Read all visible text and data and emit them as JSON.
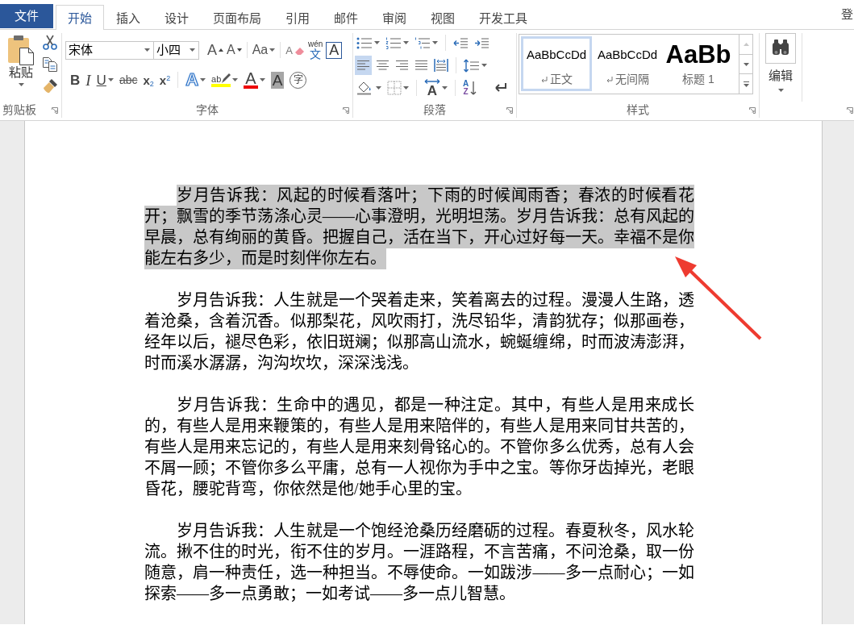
{
  "file_tab": {
    "label": "文件"
  },
  "tabs": [
    {
      "label": "开始",
      "selected": true
    },
    {
      "label": "插入",
      "selected": false
    },
    {
      "label": "设计",
      "selected": false
    },
    {
      "label": "页面布局",
      "selected": false
    },
    {
      "label": "引用",
      "selected": false
    },
    {
      "label": "邮件",
      "selected": false
    },
    {
      "label": "审阅",
      "selected": false
    },
    {
      "label": "视图",
      "selected": false
    },
    {
      "label": "开发工具",
      "selected": false
    }
  ],
  "account": {
    "label": "登"
  },
  "clipboard": {
    "label": "剪贴板",
    "paste": {
      "label": "粘贴"
    }
  },
  "font": {
    "label": "字体",
    "font_name": "宋体",
    "font_size": "小四",
    "row1": [
      {
        "kind": "grow",
        "glyph": "A"
      },
      {
        "kind": "shrink",
        "glyph": "A"
      },
      {
        "kind": "case",
        "glyph": "Aa"
      },
      {
        "kind": "clear",
        "glyph": "A"
      },
      {
        "kind": "phonetic",
        "ruby": "wén",
        "glyph": "文"
      },
      {
        "kind": "border",
        "glyph": "A"
      }
    ],
    "row2": [
      {
        "kind": "bold",
        "glyph": "B"
      },
      {
        "kind": "italic",
        "glyph": "I"
      },
      {
        "kind": "underline",
        "glyph": "U"
      },
      {
        "kind": "strike",
        "glyph": "abc"
      },
      {
        "kind": "subscript",
        "glyph": "x$_{2}$"
      },
      {
        "kind": "superscript",
        "glyph": "x$^{2}$"
      },
      {
        "kind": "effects",
        "glyph": "A"
      },
      {
        "kind": "highlight",
        "glyph": "ab"
      },
      {
        "kind": "color",
        "glyph": "A"
      },
      {
        "kind": "shading",
        "glyph": "A"
      },
      {
        "kind": "enclose",
        "glyph": "字"
      }
    ]
  },
  "paragraph": {
    "label": "段落",
    "alignment": [
      {
        "kind": "left",
        "selected": true
      },
      {
        "kind": "center",
        "selected": false
      },
      {
        "kind": "right",
        "selected": false
      },
      {
        "kind": "justify",
        "selected": false
      },
      {
        "kind": "distributed",
        "selected": false
      }
    ],
    "layout": {
      "glyph": "A"
    },
    "sort": {
      "glyphs": [
        "A",
        "Z"
      ]
    }
  },
  "styles": {
    "label": "样式",
    "items": [
      {
        "kind": "body",
        "preview": "AaBbCcDd",
        "label": "正文",
        "para_mark": true,
        "selected": true
      },
      {
        "kind": "body",
        "preview": "AaBbCcDd",
        "label": "无间隔",
        "para_mark": true,
        "selected": false
      },
      {
        "kind": "heading",
        "preview": "AaBb",
        "label": "标题 1",
        "para_mark": false,
        "selected": false
      }
    ],
    "scroll_up": {
      "disabled": true
    }
  },
  "editing": {
    "label": "编辑"
  },
  "document": {
    "paragraphs": [
      {
        "text": "岁月告诉我：风起的时候看落叶；下雨的时候闻雨香；春浓的时候看花开；飘雪的季节荡涤心灵——心事澄明，光明坦荡。岁月告诉我：总有风起的早晨，总有绚丽的黄昏。把握自己，活在当下，开心过好每一天。幸福不是你能左右多少，而是时刻伴你左右。",
        "selected": true
      },
      {
        "text": "岁月告诉我：人生就是一个哭着走来，笑着离去的过程。漫漫人生路，透着沧桑，含着沉香。似那梨花，风吹雨打，洗尽铅华，清韵犹存；似那画卷，经年以后，褪尽色彩，依旧斑斓；似那高山流水，蜿蜒缠绵，时而波涛澎湃，时而溪水潺潺，沟沟坎坎，深深浅浅。",
        "selected": false
      },
      {
        "text": "岁月告诉我：生命中的遇见，都是一种注定。其中，有些人是用来成长的，有些人是用来鞭策的，有些人是用来陪伴的，有些人是用来同甘共苦的，有些人是用来忘记的，有些人是用来刻骨铭心的。不管你多么优秀，总有人会不屑一顾；不管你多么平庸，总有一人视你为手中之宝。等你牙齿掉光，老眼昏花，腰驼背弯，你依然是他/她手心里的宝。",
        "selected": false
      },
      {
        "text": "岁月告诉我：人生就是一个饱经沧桑历经磨砺的过程。春夏秋冬，风水轮流。揪不住的时光，衔不住的岁月。一涯路程，不言苦痛，不问沧桑，取一份随意，肩一种责任，选一种担当。不辱使命。一如跋涉——多一点耐心；一如探索——多一点勇敢；一如考试——多一点儿智慧。",
        "selected": false
      }
    ]
  }
}
